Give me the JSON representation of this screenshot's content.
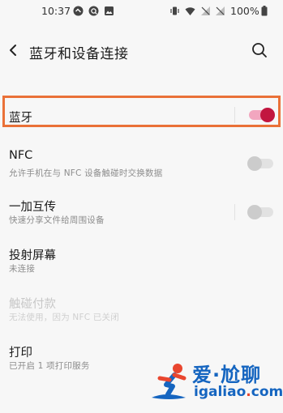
{
  "status_bar": {
    "time": "10:37",
    "battery": "100%"
  },
  "app_bar": {
    "title": "蓝牙和设备连接"
  },
  "settings": [
    {
      "key": "bluetooth",
      "title": "蓝牙",
      "subtitle": "",
      "toggle": "on",
      "has_divider": true,
      "disabled": false
    },
    {
      "key": "nfc",
      "title": "NFC",
      "subtitle": "允许手机在与 NFC 设备触碰时交换数据",
      "toggle": "off",
      "has_divider": false,
      "disabled": false
    },
    {
      "key": "oneplus-share",
      "title": "一加互传",
      "subtitle": "快速分享文件给周围设备",
      "toggle": "off",
      "has_divider": true,
      "disabled": false
    },
    {
      "key": "screen-cast",
      "title": "投射屏幕",
      "subtitle": "未连接",
      "toggle": "none",
      "has_divider": false,
      "disabled": false
    },
    {
      "key": "tap-pay",
      "title": "触碰付款",
      "subtitle": "无法使用，因为 NFC 已关闭",
      "toggle": "none",
      "has_divider": false,
      "disabled": true
    },
    {
      "key": "print",
      "title": "打印",
      "subtitle": "已开启 1 项打印服务",
      "toggle": "none",
      "has_divider": false,
      "disabled": false
    }
  ],
  "watermark": {
    "brand": "爱·尬聊",
    "url_main": "igaliao",
    "url_dot": ".",
    "url_tld": "com"
  },
  "colors": {
    "accent": "#c2163f",
    "highlight": "#ea7138",
    "watermark_blue": "#1565c0"
  }
}
